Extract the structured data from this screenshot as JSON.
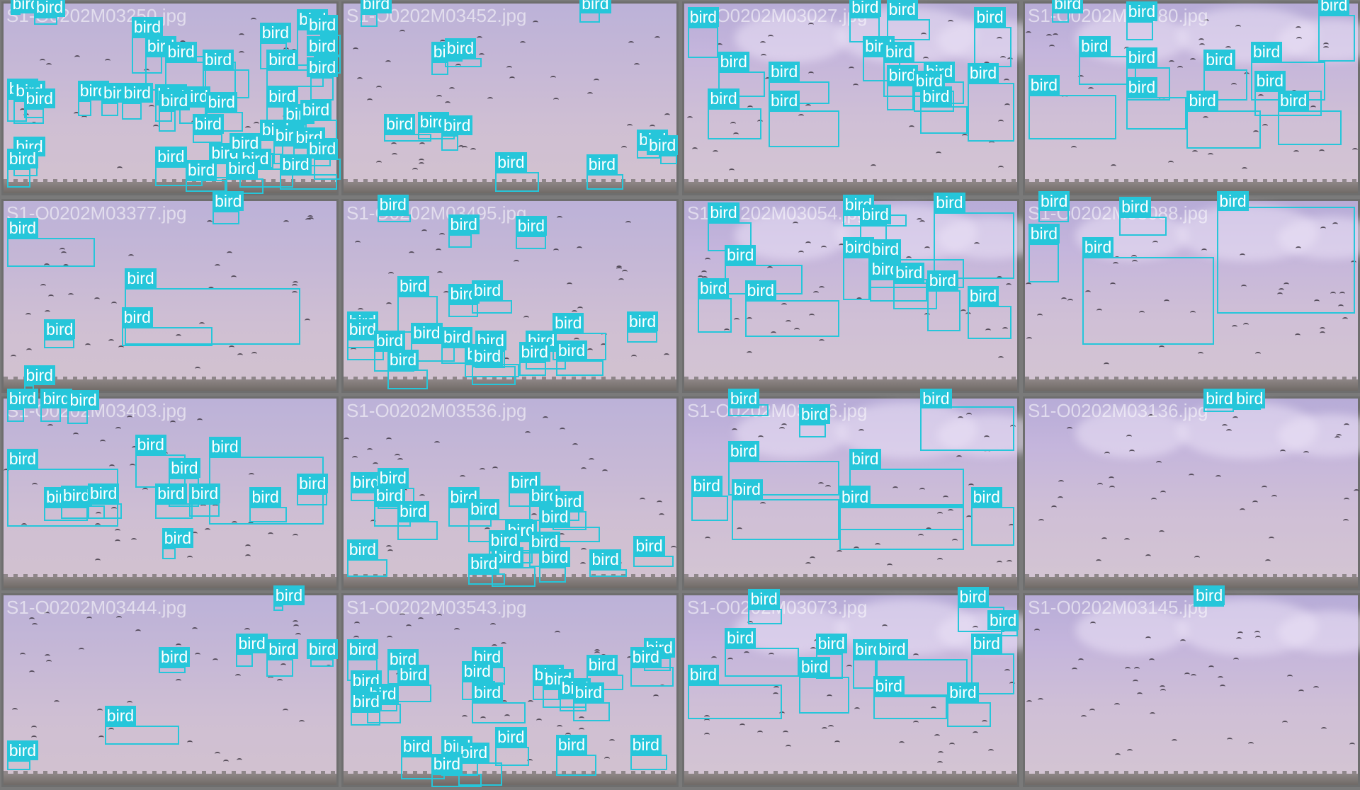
{
  "label_text": "bird",
  "colors": {
    "box": "#26c6da",
    "sky": "#c6b8d6",
    "border": "#6e6e6e"
  },
  "tiles": [
    {
      "filename": "S1-O0202M03250.jpg",
      "boxes": [
        [
          0.02,
          0.02,
          0.05,
          0.06
        ],
        [
          0.09,
          0.07,
          0.16,
          0.11
        ],
        [
          0.38,
          0.17,
          0.47,
          0.36
        ],
        [
          0.42,
          0.27,
          0.6,
          0.45
        ],
        [
          0.48,
          0.3,
          0.69,
          0.48
        ],
        [
          0.59,
          0.34,
          0.73,
          0.49
        ],
        [
          0.76,
          0.2,
          0.84,
          0.34
        ],
        [
          0.78,
          0.34,
          0.95,
          0.43
        ],
        [
          0.87,
          0.13,
          0.95,
          0.32
        ],
        [
          0.92,
          0.27,
          1.0,
          0.36
        ],
        [
          0.94,
          0.16,
          1.0,
          0.27
        ],
        [
          0.91,
          0.38,
          0.98,
          0.5
        ],
        [
          0.01,
          0.49,
          0.07,
          0.61
        ],
        [
          0.03,
          0.5,
          0.12,
          0.62
        ],
        [
          0.06,
          0.54,
          0.12,
          0.59
        ],
        [
          0.22,
          0.5,
          0.26,
          0.58
        ],
        [
          0.29,
          0.51,
          0.34,
          0.58
        ],
        [
          0.35,
          0.51,
          0.41,
          0.6
        ],
        [
          0.45,
          0.52,
          0.5,
          0.61
        ],
        [
          0.52,
          0.53,
          0.6,
          0.62
        ],
        [
          0.6,
          0.56,
          0.71,
          0.66
        ],
        [
          0.46,
          0.55,
          0.51,
          0.66
        ],
        [
          0.56,
          0.67,
          0.65,
          0.72
        ],
        [
          0.03,
          0.79,
          0.1,
          0.89
        ],
        [
          0.01,
          0.85,
          0.08,
          0.95
        ],
        [
          0.45,
          0.84,
          0.59,
          0.94
        ],
        [
          0.61,
          0.82,
          0.73,
          0.9
        ],
        [
          0.67,
          0.77,
          0.8,
          0.85
        ],
        [
          0.78,
          0.53,
          0.87,
          0.64
        ],
        [
          0.83,
          0.62,
          0.9,
          0.71
        ],
        [
          0.88,
          0.6,
          0.99,
          0.7
        ],
        [
          0.76,
          0.7,
          0.83,
          0.78
        ],
        [
          0.8,
          0.73,
          0.91,
          0.83
        ],
        [
          0.86,
          0.74,
          0.97,
          0.84
        ],
        [
          0.92,
          0.8,
          1.0,
          0.91
        ],
        [
          0.7,
          0.85,
          0.86,
          0.95
        ],
        [
          0.82,
          0.88,
          0.99,
          0.96
        ],
        [
          0.54,
          0.91,
          0.66,
          0.97
        ],
        [
          0.66,
          0.9,
          0.77,
          0.98
        ]
      ]
    },
    {
      "filename": "S1-O0202M03452.jpg",
      "boxes": [
        [
          0.05,
          0.05,
          0.1,
          0.12
        ],
        [
          0.7,
          0.04,
          0.76,
          0.1
        ],
        [
          0.26,
          0.3,
          0.31,
          0.37
        ],
        [
          0.3,
          0.28,
          0.41,
          0.33
        ],
        [
          0.12,
          0.67,
          0.26,
          0.71
        ],
        [
          0.22,
          0.66,
          0.33,
          0.7
        ],
        [
          0.29,
          0.68,
          0.34,
          0.76
        ],
        [
          0.45,
          0.87,
          0.58,
          0.97
        ],
        [
          0.72,
          0.88,
          0.83,
          0.96
        ],
        [
          0.87,
          0.75,
          0.94,
          0.8
        ],
        [
          0.94,
          0.78,
          0.99,
          0.83
        ]
      ]
    },
    {
      "filename": "S1-O0202M03027.jpg",
      "boxes": [
        [
          0.01,
          0.12,
          0.1,
          0.28
        ],
        [
          0.49,
          0.07,
          0.58,
          0.2
        ],
        [
          0.6,
          0.08,
          0.73,
          0.19
        ],
        [
          0.86,
          0.12,
          0.97,
          0.33
        ],
        [
          0.1,
          0.35,
          0.24,
          0.48
        ],
        [
          0.25,
          0.4,
          0.43,
          0.52
        ],
        [
          0.53,
          0.27,
          0.64,
          0.4
        ],
        [
          0.59,
          0.3,
          0.77,
          0.48
        ],
        [
          0.71,
          0.4,
          0.83,
          0.52
        ],
        [
          0.84,
          0.41,
          0.98,
          0.71
        ],
        [
          0.07,
          0.54,
          0.23,
          0.7
        ],
        [
          0.25,
          0.55,
          0.46,
          0.74
        ],
        [
          0.6,
          0.42,
          0.68,
          0.55
        ],
        [
          0.68,
          0.45,
          0.8,
          0.56
        ],
        [
          0.7,
          0.53,
          0.84,
          0.67
        ]
      ]
    },
    {
      "filename": "S1-O0202M03080.jpg",
      "boxes": [
        [
          0.08,
          0.04,
          0.13,
          0.1
        ],
        [
          0.3,
          0.09,
          0.38,
          0.19
        ],
        [
          0.87,
          0.06,
          0.98,
          0.3
        ],
        [
          0.16,
          0.27,
          0.33,
          0.42
        ],
        [
          0.3,
          0.33,
          0.43,
          0.5
        ],
        [
          0.53,
          0.34,
          0.66,
          0.5
        ],
        [
          0.67,
          0.3,
          0.89,
          0.5
        ],
        [
          0.68,
          0.45,
          0.88,
          0.58
        ],
        [
          0.01,
          0.47,
          0.27,
          0.7
        ],
        [
          0.3,
          0.48,
          0.48,
          0.65
        ],
        [
          0.48,
          0.55,
          0.7,
          0.75
        ],
        [
          0.75,
          0.55,
          0.94,
          0.73
        ]
      ]
    },
    {
      "filename": "S1-O0202M03377.jpg",
      "boxes": [
        [
          0.62,
          0.05,
          0.7,
          0.12
        ],
        [
          0.01,
          0.19,
          0.27,
          0.34
        ],
        [
          0.36,
          0.45,
          0.88,
          0.74
        ],
        [
          0.35,
          0.65,
          0.62,
          0.75
        ],
        [
          0.12,
          0.71,
          0.21,
          0.76
        ],
        [
          0.06,
          0.95,
          0.09,
          0.99
        ]
      ]
    },
    {
      "filename": "S1-O0202M03495.jpg",
      "boxes": [
        [
          0.1,
          0.07,
          0.2,
          0.11
        ],
        [
          0.31,
          0.17,
          0.38,
          0.24
        ],
        [
          0.51,
          0.18,
          0.6,
          0.25
        ],
        [
          0.16,
          0.49,
          0.28,
          0.68
        ],
        [
          0.31,
          0.53,
          0.4,
          0.6
        ],
        [
          0.38,
          0.51,
          0.5,
          0.58
        ],
        [
          0.01,
          0.67,
          0.14,
          0.76
        ],
        [
          0.01,
          0.71,
          0.12,
          0.82
        ],
        [
          0.09,
          0.77,
          0.21,
          0.88
        ],
        [
          0.2,
          0.73,
          0.33,
          0.83
        ],
        [
          0.29,
          0.75,
          0.38,
          0.84
        ],
        [
          0.39,
          0.77,
          0.48,
          0.86
        ],
        [
          0.54,
          0.77,
          0.66,
          0.87
        ],
        [
          0.62,
          0.68,
          0.78,
          0.82
        ],
        [
          0.63,
          0.82,
          0.77,
          0.9
        ],
        [
          0.84,
          0.67,
          0.93,
          0.73
        ],
        [
          0.36,
          0.84,
          0.52,
          0.91
        ],
        [
          0.52,
          0.83,
          0.6,
          0.9
        ],
        [
          0.13,
          0.87,
          0.25,
          0.97
        ],
        [
          0.38,
          0.85,
          0.51,
          0.95
        ]
      ]
    },
    {
      "filename": "S1-O0202M03054.jpg",
      "boxes": [
        [
          0.07,
          0.11,
          0.2,
          0.26
        ],
        [
          0.47,
          0.07,
          0.66,
          0.13
        ],
        [
          0.52,
          0.12,
          0.6,
          0.23
        ],
        [
          0.74,
          0.06,
          0.98,
          0.4
        ],
        [
          0.12,
          0.33,
          0.35,
          0.48
        ],
        [
          0.47,
          0.29,
          0.55,
          0.51
        ],
        [
          0.55,
          0.3,
          0.83,
          0.45
        ],
        [
          0.55,
          0.4,
          0.72,
          0.52
        ],
        [
          0.62,
          0.42,
          0.75,
          0.56
        ],
        [
          0.72,
          0.46,
          0.82,
          0.67
        ],
        [
          0.04,
          0.5,
          0.14,
          0.68
        ],
        [
          0.18,
          0.51,
          0.46,
          0.7
        ],
        [
          0.84,
          0.54,
          0.97,
          0.71
        ]
      ]
    },
    {
      "filename": "S1-O0202M03088.jpg",
      "boxes": [
        [
          0.04,
          0.04,
          0.13,
          0.11
        ],
        [
          0.28,
          0.08,
          0.42,
          0.18
        ],
        [
          0.57,
          0.03,
          0.98,
          0.58
        ],
        [
          0.01,
          0.22,
          0.1,
          0.42
        ],
        [
          0.17,
          0.29,
          0.56,
          0.74
        ]
      ]
    },
    {
      "filename": "S1-O0202M03403.jpg",
      "boxes": [
        [
          0.01,
          0.05,
          0.06,
          0.12
        ],
        [
          0.11,
          0.04,
          0.17,
          0.12
        ],
        [
          0.19,
          0.06,
          0.25,
          0.13
        ],
        [
          0.01,
          0.36,
          0.34,
          0.66
        ],
        [
          0.39,
          0.29,
          0.54,
          0.46
        ],
        [
          0.61,
          0.3,
          0.95,
          0.65
        ],
        [
          0.49,
          0.41,
          0.58,
          0.56
        ],
        [
          0.45,
          0.54,
          0.56,
          0.62
        ],
        [
          0.55,
          0.54,
          0.64,
          0.61
        ],
        [
          0.87,
          0.49,
          0.96,
          0.55
        ],
        [
          0.73,
          0.56,
          0.84,
          0.64
        ],
        [
          0.12,
          0.56,
          0.25,
          0.63
        ],
        [
          0.17,
          0.55,
          0.3,
          0.62
        ],
        [
          0.25,
          0.54,
          0.35,
          0.62
        ],
        [
          0.47,
          0.77,
          0.51,
          0.83
        ]
      ]
    },
    {
      "filename": "S1-O0202M03536.jpg",
      "boxes": [
        [
          0.02,
          0.48,
          0.1,
          0.53
        ],
        [
          0.1,
          0.46,
          0.21,
          0.57
        ],
        [
          0.09,
          0.55,
          0.2,
          0.66
        ],
        [
          0.16,
          0.63,
          0.28,
          0.73
        ],
        [
          0.31,
          0.56,
          0.44,
          0.66
        ],
        [
          0.37,
          0.62,
          0.56,
          0.74
        ],
        [
          0.49,
          0.48,
          0.63,
          0.56
        ],
        [
          0.55,
          0.55,
          0.7,
          0.63
        ],
        [
          0.62,
          0.58,
          0.72,
          0.68
        ],
        [
          0.58,
          0.66,
          0.76,
          0.74
        ],
        [
          0.48,
          0.73,
          0.6,
          0.8
        ],
        [
          0.43,
          0.78,
          0.56,
          0.85
        ],
        [
          0.55,
          0.79,
          0.66,
          0.87
        ],
        [
          0.01,
          0.83,
          0.13,
          0.92
        ],
        [
          0.58,
          0.87,
          0.66,
          0.95
        ],
        [
          0.44,
          0.87,
          0.57,
          0.97
        ],
        [
          0.37,
          0.9,
          0.48,
          0.96
        ],
        [
          0.73,
          0.88,
          0.84,
          0.92
        ],
        [
          0.86,
          0.81,
          0.98,
          0.87
        ]
      ]
    },
    {
      "filename": "S1-O0202M03066.jpg",
      "boxes": [
        [
          0.13,
          0.03,
          0.25,
          0.09
        ],
        [
          0.34,
          0.13,
          0.42,
          0.2
        ],
        [
          0.7,
          0.04,
          0.98,
          0.27
        ],
        [
          0.13,
          0.32,
          0.46,
          0.5
        ],
        [
          0.49,
          0.36,
          0.83,
          0.55
        ],
        [
          0.02,
          0.5,
          0.13,
          0.63
        ],
        [
          0.14,
          0.52,
          0.46,
          0.73
        ],
        [
          0.46,
          0.55,
          0.83,
          0.68
        ],
        [
          0.46,
          0.56,
          0.83,
          0.78
        ],
        [
          0.85,
          0.56,
          0.98,
          0.76
        ]
      ]
    },
    {
      "filename": "S1-O0202M03136.jpg",
      "boxes": [
        [
          0.53,
          0.02,
          0.62,
          0.07
        ],
        [
          0.62,
          0.01,
          0.7,
          0.06
        ]
      ]
    },
    {
      "filename": "S1-O0202M03444.jpg",
      "boxes": [
        [
          0.8,
          0.05,
          0.83,
          0.08
        ],
        [
          0.46,
          0.37,
          0.54,
          0.4
        ],
        [
          0.69,
          0.3,
          0.74,
          0.37
        ],
        [
          0.78,
          0.33,
          0.86,
          0.42
        ],
        [
          0.91,
          0.33,
          0.98,
          0.37
        ],
        [
          0.3,
          0.67,
          0.52,
          0.77
        ],
        [
          0.01,
          0.85,
          0.08,
          0.9
        ]
      ]
    },
    {
      "filename": "S1-O0202M03543.jpg",
      "boxes": [
        [
          0.01,
          0.33,
          0.1,
          0.44
        ],
        [
          0.13,
          0.38,
          0.22,
          0.46
        ],
        [
          0.02,
          0.49,
          0.16,
          0.6
        ],
        [
          0.16,
          0.46,
          0.26,
          0.55
        ],
        [
          0.07,
          0.56,
          0.17,
          0.66
        ],
        [
          0.02,
          0.6,
          0.11,
          0.67
        ],
        [
          0.38,
          0.37,
          0.48,
          0.46
        ],
        [
          0.35,
          0.44,
          0.45,
          0.54
        ],
        [
          0.38,
          0.55,
          0.54,
          0.66
        ],
        [
          0.56,
          0.46,
          0.64,
          0.54
        ],
        [
          0.59,
          0.48,
          0.72,
          0.58
        ],
        [
          0.64,
          0.53,
          0.72,
          0.6
        ],
        [
          0.68,
          0.55,
          0.79,
          0.65
        ],
        [
          0.72,
          0.41,
          0.83,
          0.49
        ],
        [
          0.89,
          0.32,
          0.97,
          0.39
        ],
        [
          0.85,
          0.37,
          0.98,
          0.47
        ],
        [
          0.29,
          0.83,
          0.4,
          0.93
        ],
        [
          0.45,
          0.78,
          0.55,
          0.88
        ],
        [
          0.17,
          0.83,
          0.3,
          0.95
        ],
        [
          0.34,
          0.86,
          0.47,
          0.98
        ],
        [
          0.26,
          0.92,
          0.41,
          0.99
        ],
        [
          0.63,
          0.82,
          0.75,
          0.93
        ],
        [
          0.85,
          0.82,
          0.96,
          0.9
        ]
      ]
    },
    {
      "filename": "S1-O0202M03073.jpg",
      "boxes": [
        [
          0.19,
          0.07,
          0.29,
          0.15
        ],
        [
          0.81,
          0.06,
          0.95,
          0.19
        ],
        [
          0.94,
          0.18,
          0.99,
          0.21
        ],
        [
          0.12,
          0.27,
          0.34,
          0.42
        ],
        [
          0.39,
          0.3,
          0.47,
          0.43
        ],
        [
          0.5,
          0.33,
          0.57,
          0.48
        ],
        [
          0.57,
          0.33,
          0.84,
          0.52
        ],
        [
          0.85,
          0.3,
          0.98,
          0.51
        ],
        [
          0.01,
          0.46,
          0.29,
          0.64
        ],
        [
          0.34,
          0.42,
          0.49,
          0.61
        ],
        [
          0.56,
          0.52,
          0.78,
          0.64
        ],
        [
          0.78,
          0.55,
          0.91,
          0.68
        ]
      ]
    },
    {
      "filename": "S1-O0202M03145.jpg",
      "boxes": [
        [
          0.5,
          0.01,
          0.59,
          0.06
        ]
      ]
    }
  ]
}
